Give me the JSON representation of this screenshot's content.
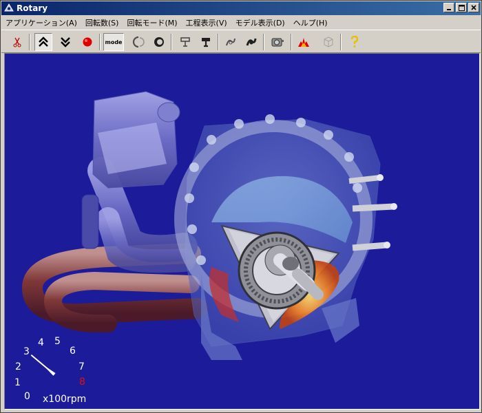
{
  "window": {
    "title": "Rotary"
  },
  "menu": [
    {
      "label": "アプリケーション(A)"
    },
    {
      "label": "回転数(S)"
    },
    {
      "label": "回転モード(M)"
    },
    {
      "label": "工程表示(V)"
    },
    {
      "label": "モデル表示(D)"
    },
    {
      "label": "ヘルプ(H)"
    }
  ],
  "toolbar": {
    "mode_label": "mode",
    "buttons": [
      {
        "icon": "scissors-icon"
      },
      {
        "icon": "double-chevron-up-icon",
        "pressed": true
      },
      {
        "icon": "double-chevron-down-icon"
      },
      {
        "icon": "record-icon",
        "color": "#e00000"
      },
      {
        "icon": "mode-icon",
        "pressed": true
      },
      {
        "icon": "rotor-outline-icon"
      },
      {
        "icon": "rotor-filled-icon"
      },
      {
        "icon": "piston-outline-icon"
      },
      {
        "icon": "piston-filled-icon"
      },
      {
        "icon": "crank-outline-icon"
      },
      {
        "icon": "crank-filled-icon"
      },
      {
        "icon": "engine-icon"
      },
      {
        "icon": "explosion-icon"
      },
      {
        "icon": "cube-icon"
      },
      {
        "icon": "help-icon"
      }
    ]
  },
  "tachometer": {
    "ticks": [
      "0",
      "1",
      "2",
      "3",
      "4",
      "5",
      "6",
      "7",
      "8"
    ],
    "redline_tick": "8",
    "unit": "x100rpm",
    "current_value": 2.4
  },
  "colors": {
    "titlebar": "#0a246a",
    "viewport_bg": "#1c1c9a",
    "redline": "#e01010"
  }
}
